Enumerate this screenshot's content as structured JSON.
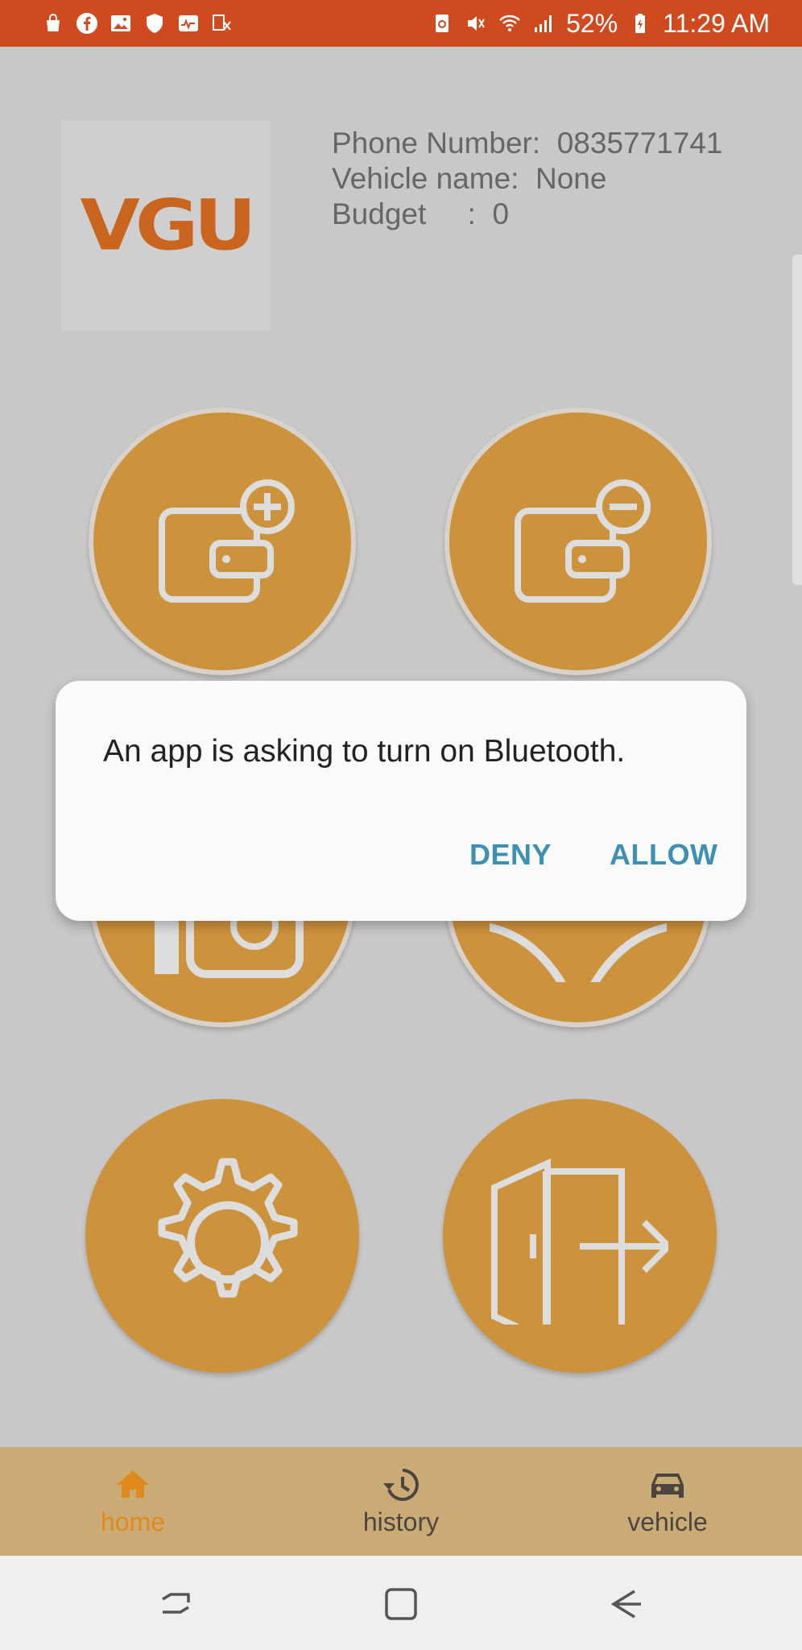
{
  "status_bar": {
    "battery": "52%",
    "time": "11:29 AM",
    "left_icons": [
      "shopping-bag-icon",
      "facebook-icon",
      "gallery-icon",
      "shield-icon",
      "activity-icon",
      "translate-icon"
    ],
    "right_icons": [
      "nfc-icon",
      "mute-icon",
      "wifi-icon",
      "signal-icon",
      "battery-icon"
    ]
  },
  "header": {
    "logo_text": "VGU",
    "phone_label": "Phone Number:",
    "phone_value": "0835771741",
    "vehicle_label": "Vehicle name:",
    "vehicle_value": "None",
    "budget_label": "Budget     :",
    "budget_value": "0"
  },
  "tiles": [
    {
      "icon": "wallet-add-icon"
    },
    {
      "icon": "wallet-remove-icon"
    },
    {
      "icon": "card-icon"
    },
    {
      "icon": "steering-wheel-icon"
    },
    {
      "icon": "gear-icon"
    },
    {
      "icon": "logout-door-icon"
    }
  ],
  "dialog": {
    "message": "An app is asking to turn on Bluetooth.",
    "deny_label": "DENY",
    "allow_label": "ALLOW"
  },
  "bottom_nav": {
    "items": [
      {
        "label": "home",
        "icon": "home-icon",
        "active": true
      },
      {
        "label": "history",
        "icon": "history-icon",
        "active": false
      },
      {
        "label": "vehicle",
        "icon": "car-icon",
        "active": false
      }
    ],
    "active_color": "#e08a1e",
    "inactive_color": "#4a4540"
  },
  "colors": {
    "status_bar": "#cf4a1f",
    "tile": "#cd923c",
    "logo": "#c9651f",
    "dialog_button": "#3d8fb3"
  }
}
